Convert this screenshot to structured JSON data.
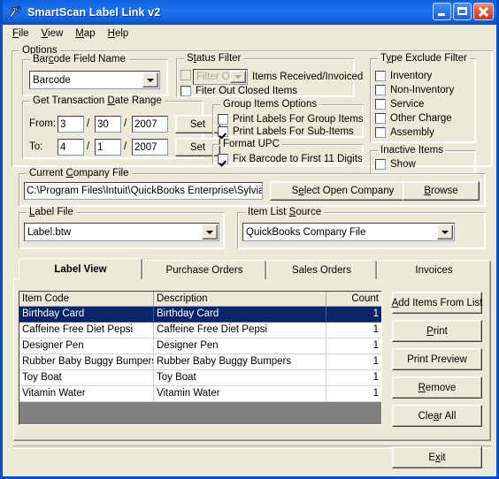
{
  "window": {
    "title": "SmartScan Label Link v2",
    "icon": "scanner-icon",
    "minimize_label": "Minimize",
    "maximize_label": "Maximize",
    "close_label": "Close",
    "accent_color": "#1d72ef",
    "face_color": "#ece9d8"
  },
  "menu": {
    "items": [
      {
        "label": "File",
        "accel": "F"
      },
      {
        "label": "View",
        "accel": "V"
      },
      {
        "label": "Map",
        "accel": "M"
      },
      {
        "label": "Help",
        "accel": "H"
      }
    ]
  },
  "options": {
    "group_title": "Options",
    "barcode_field": {
      "title": "Barcode Field Name",
      "accel": "c",
      "value": "Barcode"
    },
    "date_range": {
      "title": "Get Transaction Date Range",
      "accel": "D",
      "from_label": "From:",
      "to_label": "To:",
      "from_month": "3",
      "from_day": "30",
      "from_year": "2007",
      "to_month": "4",
      "to_day": "1",
      "to_year": "2007",
      "separator": "/",
      "set_label": "Set"
    },
    "status_filter": {
      "title": "Status Filter",
      "accel": "t",
      "dropdown_value": "Filter Out",
      "dropdown_enabled": false,
      "checkbox1_checked": false,
      "checkbox1_enabled": false,
      "items_received_label": "Items Received/Invoiced",
      "closed_items_label": "Fiter Out Closed Items",
      "closed_items_checked": false
    },
    "group_items": {
      "title": "Group Items Options",
      "print_group_label": "Print Labels For Group Items",
      "print_group_checked": false,
      "print_sub_label": "Print Labels For Sub-Items",
      "print_sub_checked": true
    },
    "format_upc": {
      "title": "Format UPC",
      "fix_barcode_label": "Fix Barcode to First 11 Digits",
      "fix_barcode_checked": true
    },
    "type_exclude": {
      "title": "Type Exclude Filter",
      "accel": "y",
      "items": [
        {
          "label": "Inventory",
          "checked": false
        },
        {
          "label": "Non-Inventory",
          "checked": false
        },
        {
          "label": "Service",
          "checked": false
        },
        {
          "label": "Other Charge",
          "checked": false
        },
        {
          "label": "Assembly",
          "checked": false
        }
      ]
    },
    "inactive_items": {
      "title": "Inactive Items",
      "show_label": "Show",
      "show_checked": false
    }
  },
  "company_file": {
    "title": "Current Company File",
    "accel": "C",
    "path": "C:\\Program Files\\Intuit\\QuickBooks Enterprise\\Sylvia",
    "select_open_label": "Select Open Company",
    "select_open_accel": "e",
    "browse_label": "Browse",
    "browse_accel": "B"
  },
  "label_file": {
    "title": "Label File",
    "accel": "L",
    "value": "Label.btw"
  },
  "item_list_source": {
    "title": "Item List Source",
    "accel": "S",
    "value": "QuickBooks Company File"
  },
  "tabs": [
    {
      "label": "Label View",
      "active": true
    },
    {
      "label": "Purchase Orders",
      "active": false
    },
    {
      "label": "Sales Orders",
      "active": false
    },
    {
      "label": "Invoices",
      "active": false
    }
  ],
  "grid": {
    "columns": [
      "Item Code",
      "Description",
      "Count"
    ],
    "rows": [
      {
        "item_code": "Birthday Card",
        "description": "Birthday Card",
        "count": "1",
        "selected": true
      },
      {
        "item_code": "Caffeine Free Diet Pepsi",
        "description": "Caffeine Free Diet Pepsi",
        "count": "1",
        "selected": false
      },
      {
        "item_code": "Designer Pen",
        "description": "Designer Pen",
        "count": "1",
        "selected": false
      },
      {
        "item_code": "Rubber Baby Buggy Bumpers",
        "description": "Rubber Baby Buggy Bumpers",
        "count": "1",
        "selected": false
      },
      {
        "item_code": "Toy Boat",
        "description": "Toy Boat",
        "count": "1",
        "selected": false
      },
      {
        "item_code": "Vitamin Water",
        "description": "Vitamin Water",
        "count": "1",
        "selected": false
      }
    ],
    "selection_color": "#0a246a",
    "empty_area_color": "#808080"
  },
  "actions": {
    "add_items_label": "Add Items From List",
    "add_items_accel": "A",
    "print_label": "Print",
    "print_accel": "P",
    "print_preview_label": "Print Preview",
    "remove_label": "Remove",
    "remove_accel": "R",
    "clear_all_label": "Clear All",
    "clear_all_accel": "a",
    "exit_label": "Exit",
    "exit_accel": "x"
  }
}
